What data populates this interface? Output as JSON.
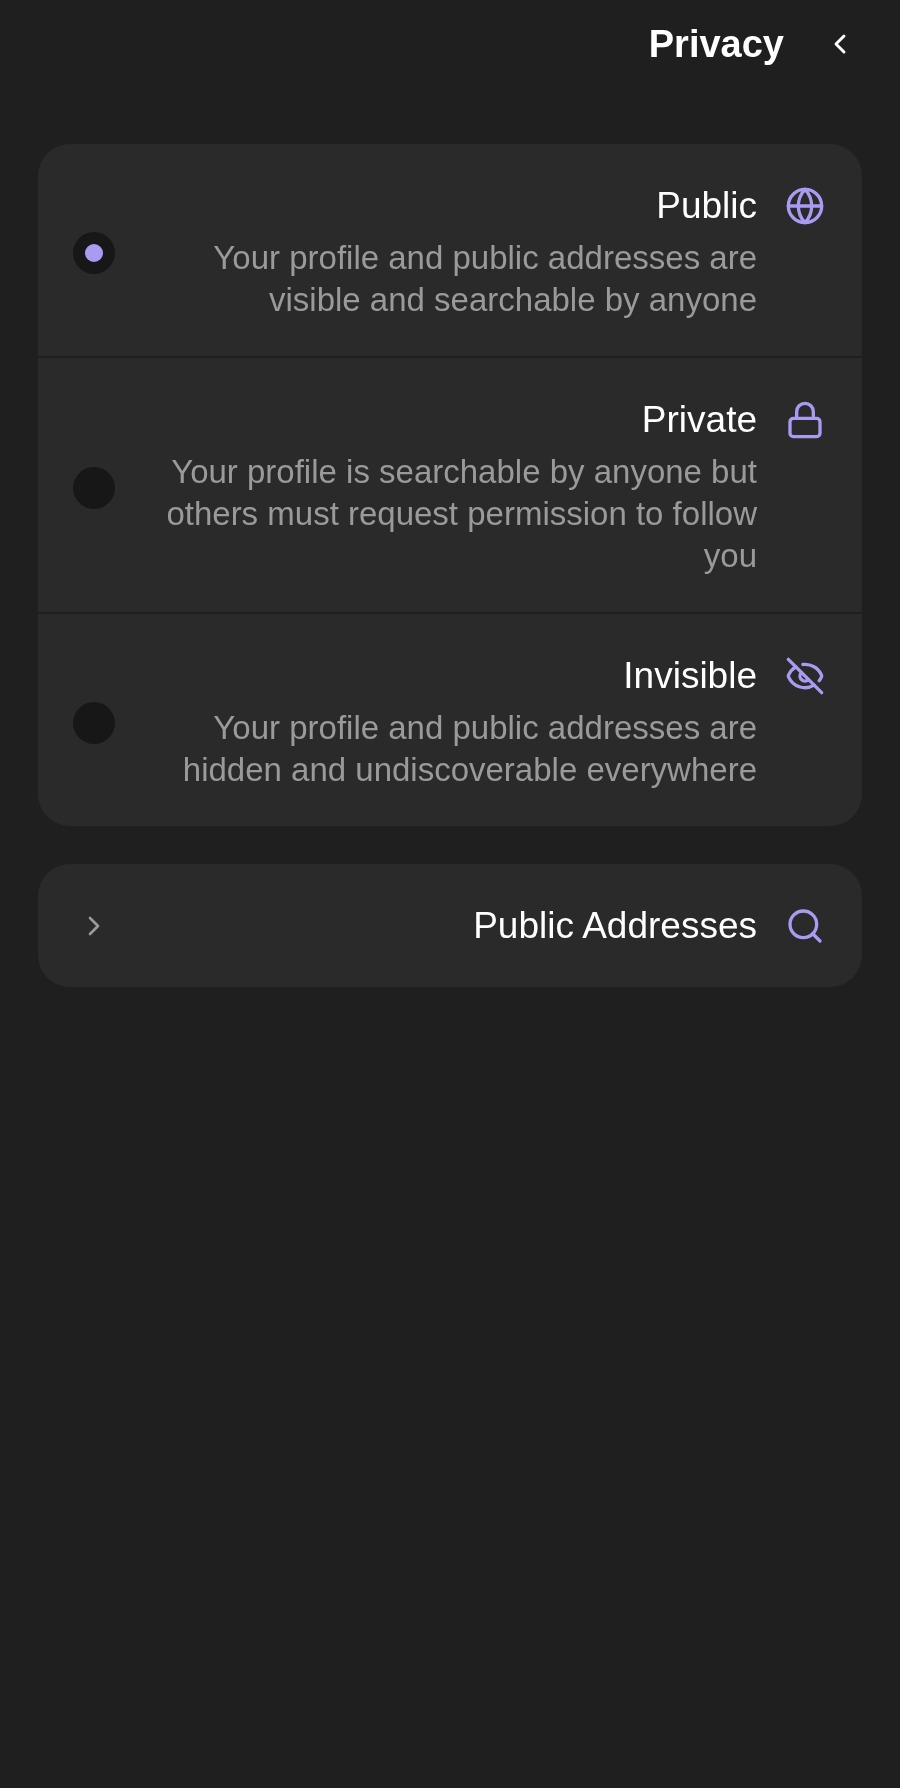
{
  "header": {
    "title": "Privacy"
  },
  "privacy_options": [
    {
      "title": "Public",
      "description": "Your profile and public addresses are visible and searchable by anyone",
      "selected": true
    },
    {
      "title": "Private",
      "description": "Your profile is searchable by anyone but others must request permission to follow you",
      "selected": false
    },
    {
      "title": "Invisible",
      "description": "Your profile and public addresses are hidden and undiscoverable everywhere",
      "selected": false
    }
  ],
  "links": [
    {
      "label": "Public Addresses"
    }
  ]
}
